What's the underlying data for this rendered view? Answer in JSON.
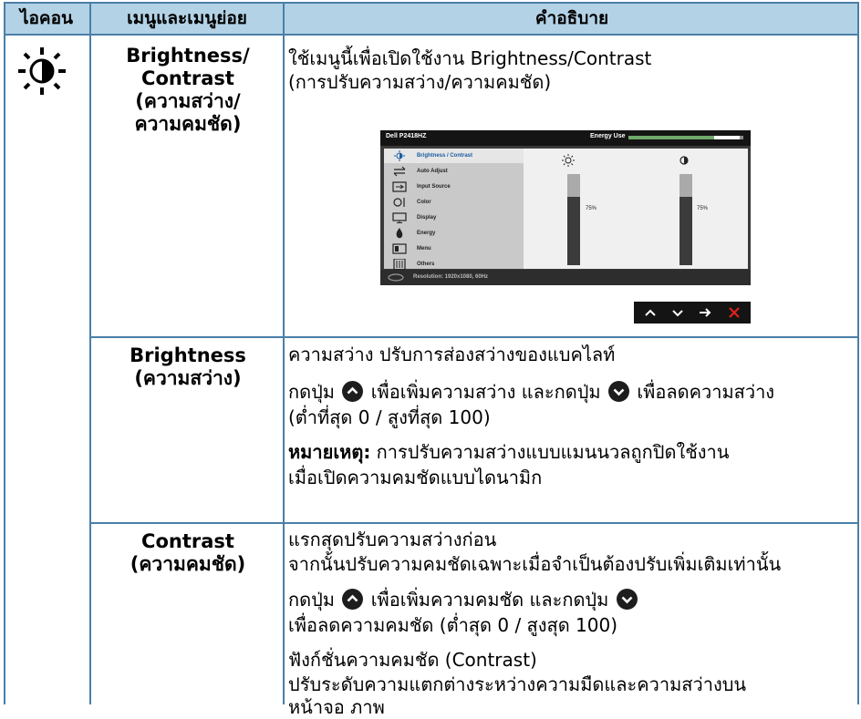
{
  "header": {
    "icon_col": "ไอคอน",
    "menu_col": "เมนูและเมนูย่อย",
    "desc_col": "คำอธิบาย"
  },
  "row1": {
    "icon": "sun-contrast-icon",
    "menu_line1": "Brightness/",
    "menu_line2": "Contrast",
    "menu_line3": "(ความสว่าง/",
    "menu_line4": "ความคมชัด)",
    "desc_line1": "ใช้เมนูนี้เพื่อเปิดใช้งาน Brightness/Contrast",
    "desc_line2": "(การปรับความสว่าง/ความคมชัด)"
  },
  "osd": {
    "model": "Dell P2418HZ",
    "energy_label": "Energy Use",
    "energy_level": 0.75,
    "menu_items": [
      {
        "label": "Brightness / Contrast",
        "icon": "brightness-icon",
        "selected": true
      },
      {
        "label": "Auto Adjust",
        "icon": "auto-adjust-icon",
        "selected": false
      },
      {
        "label": "Input Source",
        "icon": "input-source-icon",
        "selected": false
      },
      {
        "label": "Color",
        "icon": "color-icon",
        "selected": false
      },
      {
        "label": "Display",
        "icon": "display-icon",
        "selected": false
      },
      {
        "label": "Energy",
        "icon": "energy-icon",
        "selected": false
      },
      {
        "label": "Menu",
        "icon": "menu-icon",
        "selected": false
      },
      {
        "label": "Others",
        "icon": "others-icon",
        "selected": false
      }
    ],
    "brightness_pct": "75%",
    "brightness_value": 0.75,
    "contrast_pct": "75%",
    "contrast_value": 0.75,
    "resolution": "Resolution: 1920x1080, 60Hz",
    "nav": [
      "up-icon",
      "down-icon",
      "right-arrow-icon",
      "close-icon"
    ],
    "accent_color": "#1a5ea0",
    "close_color": "#e02020"
  },
  "row2": {
    "menu_line1": "Brightness",
    "menu_line2": "(ความสว่าง)",
    "desc_line1": "ความสว่าง ปรับการส่องสว่างของแบคไลท์",
    "desc_line2a": "กดปุ่ม",
    "desc_line2b": "เพื่อเพิ่มความสว่าง และกดปุ่ม",
    "desc_line2c": "เพื่อลดความสว่าง",
    "desc_line3": "(ต่ำที่สุด 0 / สูงที่สุด 100)",
    "note_label": "หมายเหตุ:",
    "note_text": " การปรับความสว่างแบบแมนนวลถูกปิดใช้งาน",
    "note_line2": "เมื่อเปิดความคมชัดแบบไดนามิก"
  },
  "row3": {
    "menu_line1": "Contrast",
    "menu_line2": "(ความคมชัด)",
    "desc_line1": "แรกสุดปรับความสว่างก่อน",
    "desc_line2": "จากนั้นปรับความคมชัดเฉพาะเมื่อจำเป็นต้องปรับเพิ่มเติมเท่านั้น",
    "desc_line3a": "กดปุ่ม",
    "desc_line3b": "เพื่อเพิ่มความคมชัด และกดปุ่ม",
    "desc_line4": "เพื่อลดความคมชัด (ต่ำสุด 0 / สูงสุด 100)",
    "desc_line5": "ฟังก์ชั่นความคมชัด (Contrast)",
    "desc_line6": "ปรับระดับความแตกต่างระหว่างความมืดและความสว่างบน",
    "desc_line7": "หน้าจอ ภาพ"
  }
}
